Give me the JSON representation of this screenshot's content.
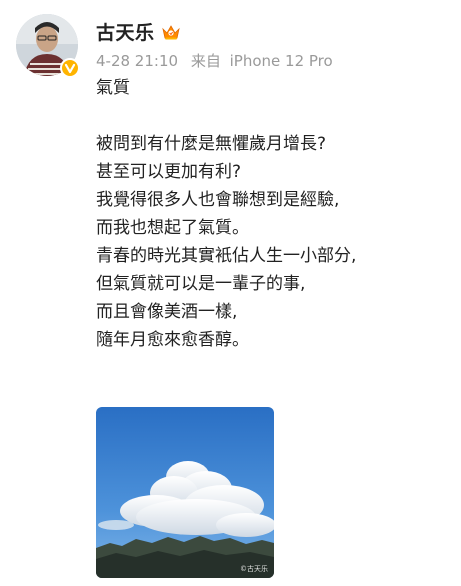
{
  "user": {
    "name": "古天乐",
    "badge_icon": "crown-icon",
    "verified_icon": "verified-v-icon",
    "accent_color": "#ffb400"
  },
  "post": {
    "date": "4-28 21:10",
    "source_prefix": "来自",
    "device": "iPhone 12 Pro",
    "lines": [
      "氣質",
      "",
      "被問到有什麼是無懼歲月增長?",
      "甚至可以更加有利?",
      "我覺得很多人也會聯想到是經驗,",
      "而我也想起了氣質。",
      "青春的時光其實衹佔人生一小部分,",
      "但氣質就可以是一輩子的事,",
      "而且會像美酒一樣,",
      "隨年月愈來愈香醇。"
    ],
    "image": {
      "subject": "cloud-over-mountains-photo",
      "watermark": "©古天乐"
    }
  }
}
